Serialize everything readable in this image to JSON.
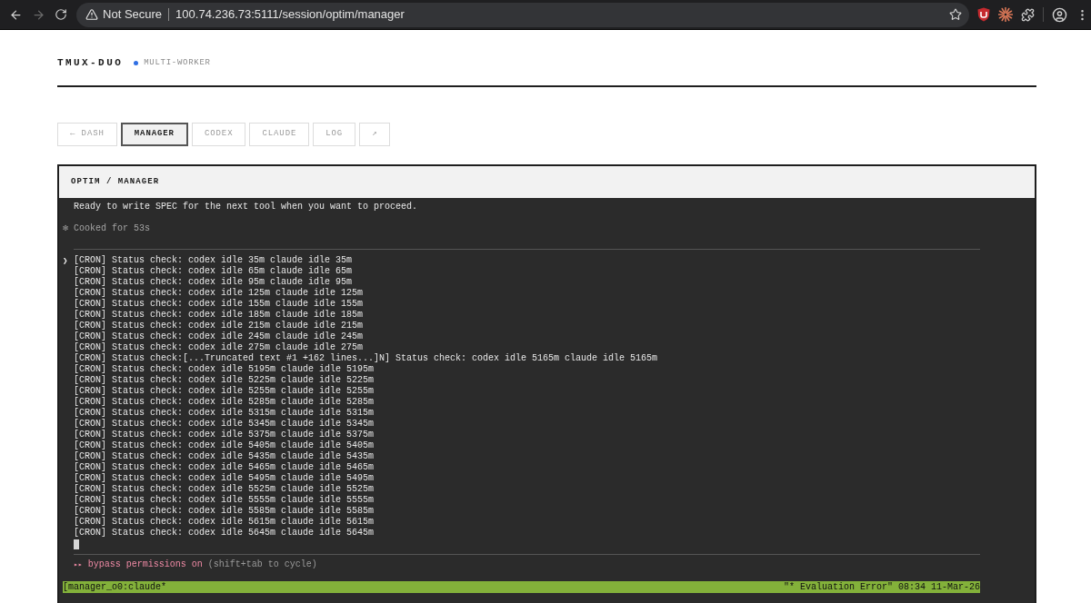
{
  "browser": {
    "security_label": "Not Secure",
    "url": "100.74.236.73:5111/session/optim/manager",
    "forward_disabled": true
  },
  "header": {
    "title": "TMUX-DUO",
    "subtitle": "MULTI-WORKER"
  },
  "tabs": [
    {
      "label": "← DASH",
      "selected": false
    },
    {
      "label": "MANAGER",
      "selected": true
    },
    {
      "label": "CODEX",
      "selected": false
    },
    {
      "label": "CLAUDE",
      "selected": false
    },
    {
      "label": "LOG",
      "selected": false
    },
    {
      "label": "↗",
      "selected": false
    }
  ],
  "panel": {
    "title": "OPTIM / MANAGER"
  },
  "terminal": {
    "message": "Ready to write SPEC for the next tool when you want to proceed.",
    "timing": "✻ Cooked for 53s",
    "prompt": "❯",
    "lines": [
      "[CRON] Status check: codex idle 35m claude idle 35m",
      "[CRON] Status check: codex idle 65m claude idle 65m",
      "[CRON] Status check: codex idle 95m claude idle 95m",
      "[CRON] Status check: codex idle 125m claude idle 125m",
      "[CRON] Status check: codex idle 155m claude idle 155m",
      "[CRON] Status check: codex idle 185m claude idle 185m",
      "[CRON] Status check: codex idle 215m claude idle 215m",
      "[CRON] Status check: codex idle 245m claude idle 245m",
      "[CRON] Status check: codex idle 275m claude idle 275m",
      "[CRON] Status check:[...Truncated text #1 +162 lines...]N] Status check: codex idle 5165m claude idle 5165m",
      "[CRON] Status check: codex idle 5195m claude idle 5195m",
      "[CRON] Status check: codex idle 5225m claude idle 5225m",
      "[CRON] Status check: codex idle 5255m claude idle 5255m",
      "[CRON] Status check: codex idle 5285m claude idle 5285m",
      "[CRON] Status check: codex idle 5315m claude idle 5315m",
      "[CRON] Status check: codex idle 5345m claude idle 5345m",
      "[CRON] Status check: codex idle 5375m claude idle 5375m",
      "[CRON] Status check: codex idle 5405m claude idle 5405m",
      "[CRON] Status check: codex idle 5435m claude idle 5435m",
      "[CRON] Status check: codex idle 5465m claude idle 5465m",
      "[CRON] Status check: codex idle 5495m claude idle 5495m",
      "[CRON] Status check: codex idle 5525m claude idle 5525m",
      "[CRON] Status check: codex idle 5555m claude idle 5555m",
      "[CRON] Status check: codex idle 5585m claude idle 5585m",
      "[CRON] Status check: codex idle 5615m claude idle 5615m",
      "[CRON] Status check: codex idle 5645m claude idle 5645m"
    ],
    "mode": {
      "indicator": "▸▸",
      "label": "bypass permissions on",
      "hint": "(shift+tab to cycle)"
    },
    "status_bar": {
      "left": "[manager_o0:claude*",
      "right": "\"* Evaluation Error\" 08:34 11-Mar-26"
    }
  }
}
